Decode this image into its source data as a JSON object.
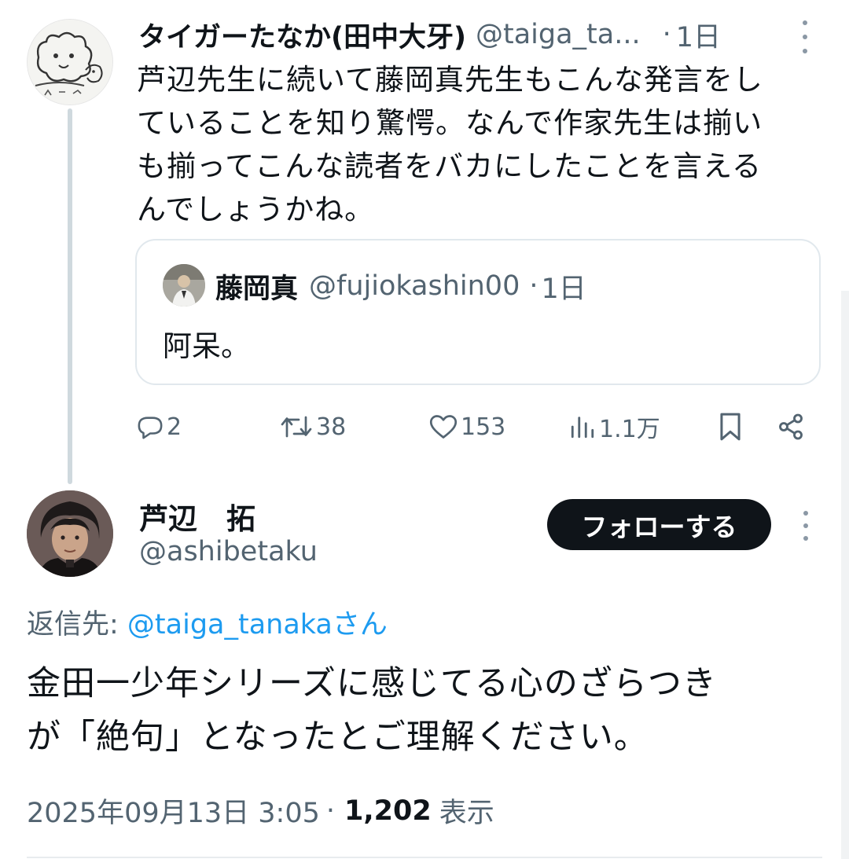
{
  "parent_tweet": {
    "display_name": "タイガーたなか(田中大牙)",
    "handle": "@taiga_ta...",
    "separator": "·",
    "time": "1日",
    "avatar_icon": "cat-doodle-avatar",
    "body_lines": [
      "芦辺先生に続いて藤岡真先生もこんな発言をし",
      "ていることを知り驚愕。なんで作家先生は揃い",
      "も揃ってこんな読者をバカにしたことを言える",
      "んでしょうかね。"
    ],
    "quote": {
      "display_name": "藤岡真",
      "handle": "@fujiokashin00",
      "separator": "·",
      "time": "1日",
      "text": "阿呆。"
    },
    "actions": {
      "replies": "2",
      "retweets": "38",
      "likes": "153",
      "views": "1.1万"
    }
  },
  "reply_tweet": {
    "display_name": "芦辺　拓",
    "handle": "@ashibetaku",
    "follow_label": "フォローする",
    "reply_prefix": "返信先: ",
    "reply_handle": "@taiga_tanakaさん",
    "body_lines": [
      "金田一少年シリーズに感じてる心のざらつき",
      "が「絶句」となったとご理解ください。"
    ],
    "timestamp": "2025年09月13日 3:05",
    "separator": "·",
    "view_count": "1,202",
    "view_label": "表示"
  },
  "colors": {
    "text_primary": "#0f1419",
    "text_secondary": "#536471",
    "link": "#1d9bf0",
    "border": "#e1e8ed",
    "follow_bg": "#0f1419"
  }
}
